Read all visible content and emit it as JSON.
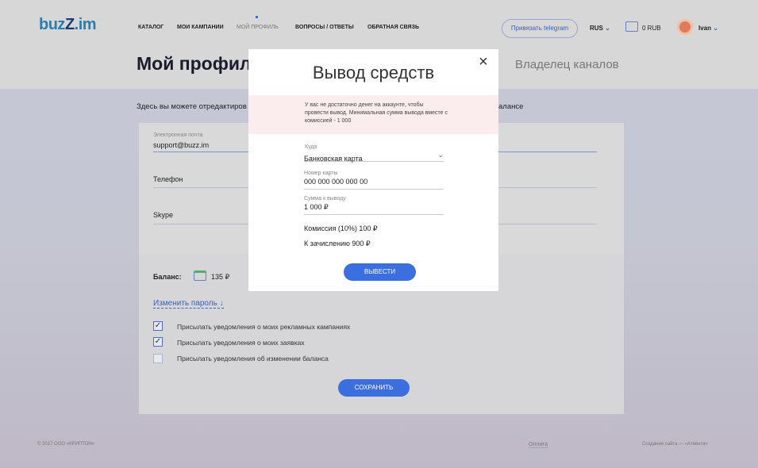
{
  "header": {
    "logo": "buzz.im",
    "nav": [
      "КАТАЛОГ",
      "МОИ КАМПАНИИ",
      "МОЙ ПРОФИЛЬ",
      "ВОПРОСЫ / ОТВЕТЫ",
      "ОБРАТНАЯ СВЯЗЬ"
    ],
    "telegram": "Привязать telegram",
    "lang": "RUS",
    "wallet": "0 RUB",
    "user": "Ivan"
  },
  "page": {
    "title": "Мой профиль",
    "tab_owner": "Владелец каналов",
    "intro": "Здесь вы можете отредактиров",
    "intro_tail": "алансе"
  },
  "form": {
    "email_label": "Электронная почта",
    "email": "support@buzz.im",
    "phone": "Телефон",
    "skype": "Skype",
    "balance_label": "Баланс:",
    "balance": "135 ₽",
    "change_password": "Изменить пароль ↓",
    "checks": [
      {
        "label": "Присылать уведомления о моих рекламных кампаниях",
        "checked": true
      },
      {
        "label": "Присылать уведомления о моих заявках",
        "checked": true
      },
      {
        "label": "Присылать уведомления об изменении баланса",
        "checked": false
      }
    ],
    "save": "СОХРАНИТЬ"
  },
  "modal": {
    "title": "Вывод средств",
    "alert": "У вас не достаточно денег на аккаунте, чтобы провести вывод. Минимальная сумма вывода вместе с комиссией - 1 000",
    "where_label": "Куда",
    "where": "Банковская карта",
    "card_label": "Номер карты",
    "card": "000 000 000 000 00",
    "amount_label": "Сумма к выводу",
    "amount": "1 000 ₽",
    "commission": "Комиссия (10%) 100 ₽",
    "credit": "К зачислению 900 ₽",
    "submit": "ВЫВЕСТИ",
    "close": "×"
  },
  "footer": {
    "copyright": "© 2017 ООО «КРИПТОН»",
    "payment": "Оплата",
    "credits": "Создание сайта — «Атвента»"
  }
}
